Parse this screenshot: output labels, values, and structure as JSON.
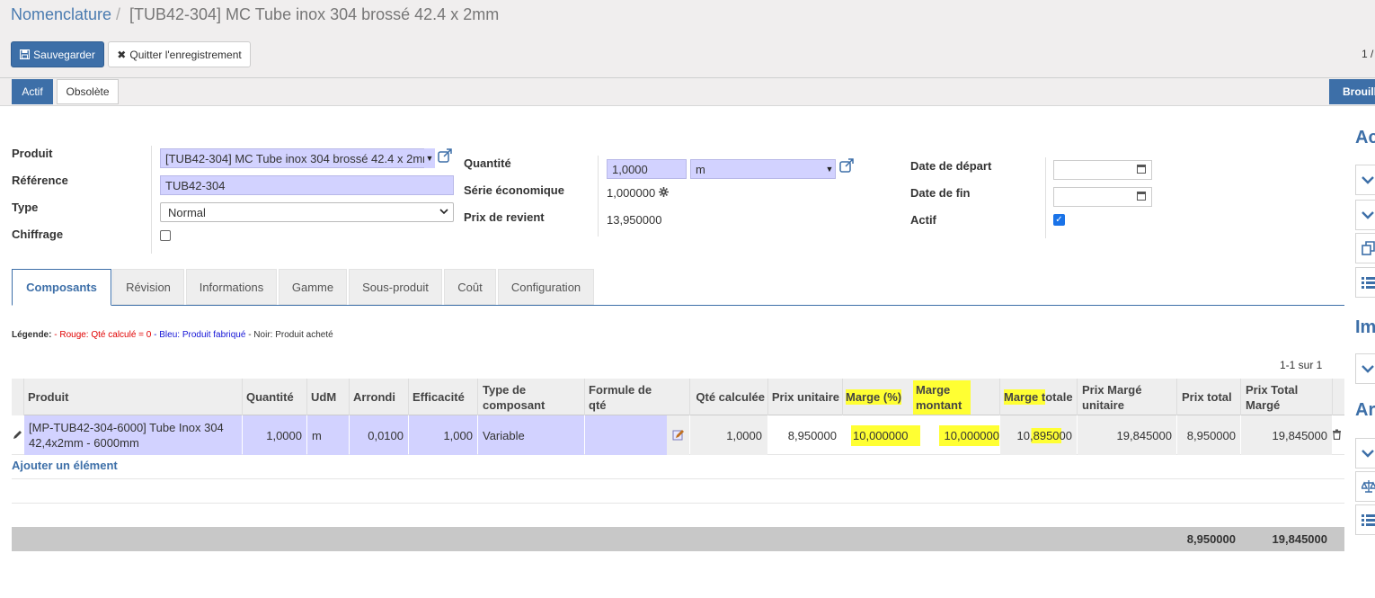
{
  "breadcrumb": {
    "root": "Nomenclature",
    "separator": "/",
    "current": "[TUB42-304] MC Tube inox 304 brossé 42.4 x 2mm"
  },
  "toolbar": {
    "save_label": "Sauvegarder",
    "quit_label": "Quitter l'enregistrement",
    "pager": "1 /"
  },
  "statusbar": {
    "states": [
      "Actif",
      "Obsolète"
    ],
    "active_state": "Actif",
    "draft_button": "Brouillon"
  },
  "form": {
    "produit_label": "Produit",
    "produit_value": "[TUB42-304] MC Tube inox 304 brossé 42.4 x 2mm",
    "reference_label": "Référence",
    "reference_value": "TUB42-304",
    "type_label": "Type",
    "type_value": "Normal",
    "chiffrage_label": "Chiffrage",
    "chiffrage_checked": false,
    "quantite_label": "Quantité",
    "quantite_value": "1,0000",
    "uom_value": "m",
    "serie_label": "Série économique",
    "serie_value": "1,000000",
    "prix_label": "Prix de revient",
    "prix_value": "13,950000",
    "date_depart_label": "Date de départ",
    "date_depart_value": "",
    "date_fin_label": "Date de fin",
    "date_fin_value": "",
    "actif_label": "Actif",
    "actif_checked": true
  },
  "tabs": [
    "Composants",
    "Révision",
    "Informations",
    "Gamme",
    "Sous-produit",
    "Coût",
    "Configuration"
  ],
  "active_tab": "Composants",
  "legend": {
    "prefix": "Légende:",
    "red": "- Rouge: Qté calculé = 0",
    "blue": "- Bleu: Produit fabriqué",
    "black": "- Noir: Produit acheté"
  },
  "components": {
    "count": "1-1 sur 1",
    "headers": {
      "produit": "Produit",
      "quantite": "Quantité",
      "udm": "UdM",
      "arrondi": "Arrondi",
      "efficacite": "Efficacité",
      "type_line1": "Type de",
      "type_line2": "composant",
      "formule_line1": "Formule de",
      "formule_line2": "qté",
      "qte_calc": "Qté calculée",
      "prix_unitaire": "Prix unitaire",
      "marge_pct": "Marge (%)",
      "marge_montant_line1": "Marge",
      "marge_montant_line2": "montant",
      "marge_totale": "Marge totale",
      "prix_marge_line1": "Prix Margé",
      "prix_marge_line2": "unitaire",
      "prix_total": "Prix total",
      "prix_total_marge_line1": "Prix Total",
      "prix_total_marge_line2": "Margé"
    },
    "rows": [
      {
        "produit_line1": "[MP-TUB42-304-6000] Tube Inox 304",
        "produit_line2": "42,4x2mm - 6000mm",
        "quantite": "1,0000",
        "udm": "m",
        "arrondi": "0,0100",
        "efficacite": "1,000",
        "type": "Variable",
        "formule": "",
        "qte_calculee": "1,0000",
        "prix_unitaire": "8,950000",
        "marge_pct": "10,000000",
        "marge_montant": "10,000000",
        "marge_totale": "10,895000",
        "prix_marge_unitaire": "19,845000",
        "prix_total": "8,950000",
        "prix_total_marge": "19,845000"
      }
    ],
    "add_line": "Ajouter un élément",
    "footer": {
      "prix_total": "8,950000",
      "prix_total_marge": "19,845000"
    }
  },
  "sidebar": {
    "heading1": "Ac",
    "heading2": "Im",
    "heading3": "Ar"
  },
  "colors": {
    "primary": "#3d6fa8",
    "many2one_bg": "#d2d2ff",
    "highlight": "#ffff33",
    "legend_red": "#e00000",
    "legend_blue": "#1414d6"
  },
  "icons": [
    "floppy-disk-icon",
    "close-icon",
    "external-link-icon",
    "gear-icon",
    "calendar-icon",
    "pencil-icon",
    "formula-edit-icon",
    "trash-icon",
    "chevron-down-icon",
    "copy-icon",
    "list-icon",
    "balance-icon"
  ]
}
